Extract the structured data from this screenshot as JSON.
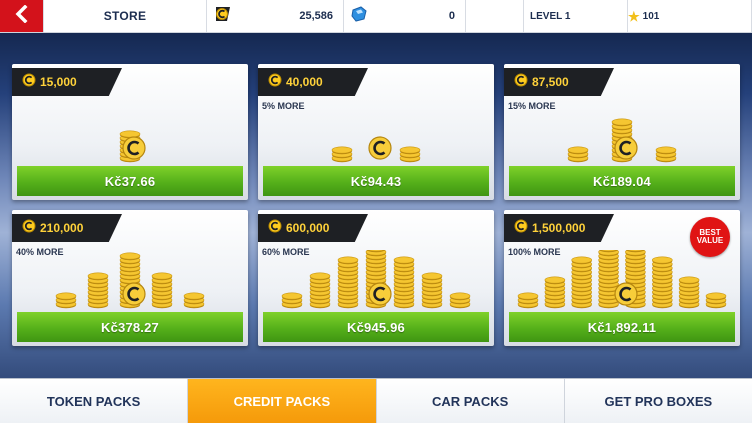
{
  "topbar": {
    "title": "STORE",
    "credits_icon": "credits-coin-icon",
    "credits": "25,586",
    "tokens_icon": "token-icon",
    "tokens": "0",
    "level": "LEVEL 1",
    "star_icon": "star-icon",
    "stars": "101"
  },
  "packs": [
    {
      "amount": "15,000",
      "more": "",
      "price": "Kč37.66",
      "best": false
    },
    {
      "amount": "40,000",
      "more": "5% MORE",
      "price": "Kč94.43",
      "best": false
    },
    {
      "amount": "87,500",
      "more": "15% MORE",
      "price": "Kč189.04",
      "best": false
    },
    {
      "amount": "210,000",
      "more": "40% MORE",
      "price": "Kč378.27",
      "best": false
    },
    {
      "amount": "600,000",
      "more": "60% MORE",
      "price": "Kč945.96",
      "best": false
    },
    {
      "amount": "1,500,000",
      "more": "100% MORE",
      "price": "Kč1,892.11",
      "best": true
    }
  ],
  "badge": {
    "line1": "BEST",
    "line2": "VALUE"
  },
  "tabs": [
    {
      "label": "TOKEN PACKS",
      "active": false
    },
    {
      "label": "CREDIT PACKS",
      "active": true
    },
    {
      "label": "CAR PACKS",
      "active": false
    },
    {
      "label": "GET PRO BOXES",
      "active": false
    }
  ],
  "colors": {
    "accent_green": "#55b01a",
    "accent_orange": "#f59a0a",
    "back_red": "#d3121b",
    "coin_gold": "#ffd23a"
  }
}
